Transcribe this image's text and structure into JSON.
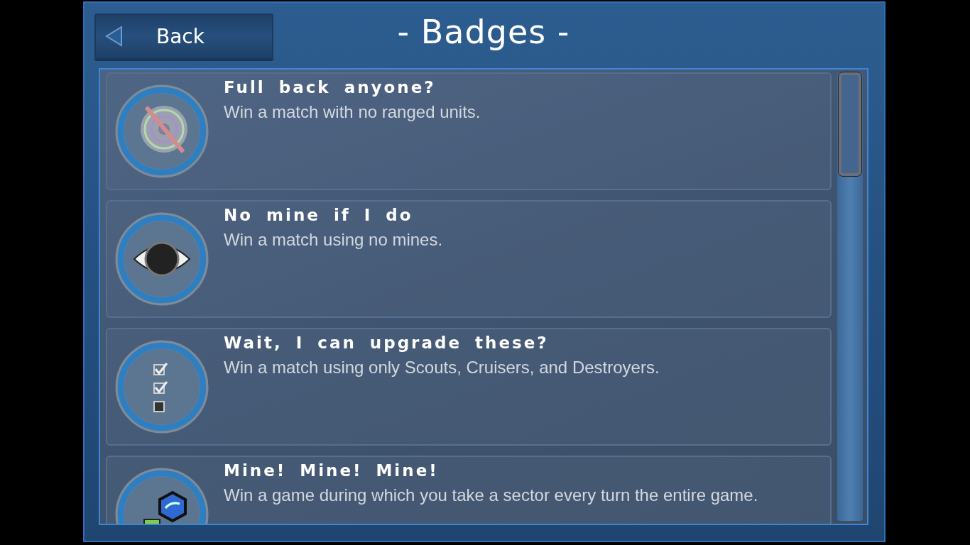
{
  "header": {
    "back_button": "Back",
    "title": "- Badges -"
  },
  "badges": [
    {
      "title": "Full back anyone?",
      "description": "Win a match with no ranged units."
    },
    {
      "title": "No mine if I do",
      "description": "Win a match using no mines."
    },
    {
      "title": "Wait, I can upgrade these?",
      "description": "Win a match using only Scouts, Cruisers, and Destroyers."
    },
    {
      "title": "Mine! Mine! Mine!",
      "description": "Win a game during which you take a sector every turn the entire game."
    }
  ]
}
